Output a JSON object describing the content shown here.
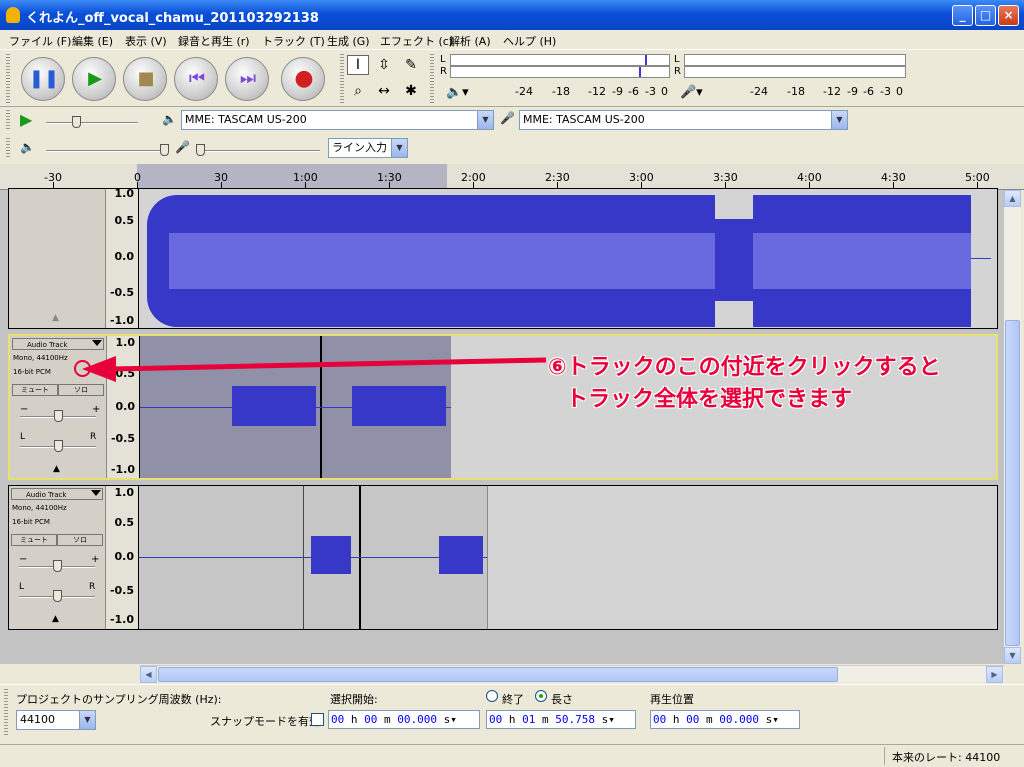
{
  "window": {
    "title": "くれよん_off_vocal_chamu_201103292138",
    "minimize": "_",
    "maximize": "□",
    "close": "×"
  },
  "menu": [
    "ファイル (F)",
    "編集 (E)",
    "表示 (V)",
    "録音と再生 (r)",
    "トラック (T)",
    "生成 (G)",
    "エフェクト (c)",
    "解析 (A)",
    "ヘルプ (H)"
  ],
  "transport": {
    "pause": "❚❚",
    "play": "▶",
    "stop": "■",
    "skip_start": "⏮",
    "skip_end": "⏭",
    "record": "●"
  },
  "tools": {
    "select": "I",
    "envelope": "⇳",
    "draw": "✎",
    "zoom": "⌕",
    "timeshift": "↔",
    "multi": "✱"
  },
  "meters": {
    "left": "L",
    "right": "R",
    "ticks": [
      "-24",
      "-18",
      "-12",
      "-9",
      "-6",
      "-3",
      "0"
    ]
  },
  "devices": {
    "output": "MME: TASCAM US-200",
    "input": "MME: TASCAM US-200",
    "input_source": "ライン入力"
  },
  "ruler": {
    "labels": [
      "-30",
      "0",
      "30",
      "1:00",
      "1:30",
      "2:00",
      "2:30",
      "3:00",
      "3:30",
      "4:00",
      "4:30",
      "5:00"
    ]
  },
  "tracks": [
    {
      "name": "",
      "info1": "",
      "info2": "",
      "mute": "",
      "solo": ""
    },
    {
      "name": "Audio Track",
      "info1": "Mono, 44100Hz",
      "info2": "16-bit PCM",
      "mute": "ミュート",
      "solo": "ソロ"
    },
    {
      "name": "Audio Track",
      "info1": "Mono, 44100Hz",
      "info2": "16-bit PCM",
      "mute": "ミュート",
      "solo": "ソロ"
    }
  ],
  "vruler": [
    "1.0",
    "0.5",
    "0.0",
    "-0.5",
    "-1.0"
  ],
  "gain": {
    "minus": "−",
    "plus": "+"
  },
  "pan": {
    "left": "L",
    "right": "R"
  },
  "annotation": {
    "line1": "⑥トラックのこの付近をクリックすると",
    "line2": "トラック全体を選択できます"
  },
  "status": {
    "project_rate_label": "プロジェクトのサンプリング周波数 (Hz):",
    "project_rate": "44100",
    "snap_label": "スナップモードを有効",
    "sel_start_label": "選択開始:",
    "end_label": "終了",
    "length_label": "長さ",
    "playpos_label": "再生位置",
    "sel_start": {
      "h": "00",
      "m": "00",
      "s": "00.000"
    },
    "length": {
      "h": "00",
      "m": "01",
      "s": "50.758"
    },
    "playpos": {
      "h": "00",
      "m": "00",
      "s": "00.000"
    },
    "actual_rate": "本来のレート: 44100"
  },
  "colors": {
    "waveform": "#3737c8",
    "selection": "#9090a8",
    "annotation": "#e8003a"
  }
}
